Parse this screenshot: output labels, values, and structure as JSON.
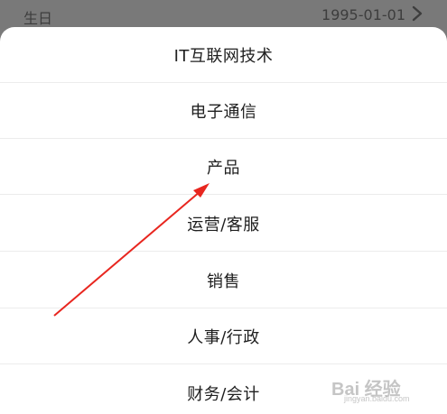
{
  "backdrop": {
    "label": "生日",
    "value": "1995-01-01"
  },
  "options": [
    {
      "label": "IT互联网技术"
    },
    {
      "label": "电子通信"
    },
    {
      "label": "产品"
    },
    {
      "label": "运营/客服"
    },
    {
      "label": "销售"
    },
    {
      "label": "人事/行政"
    },
    {
      "label": "财务/会计"
    }
  ],
  "annotation": {
    "arrow_color": "#e8261f"
  },
  "watermark": {
    "text": "Bai 经验",
    "sub": "jingyan.baidu.com"
  }
}
